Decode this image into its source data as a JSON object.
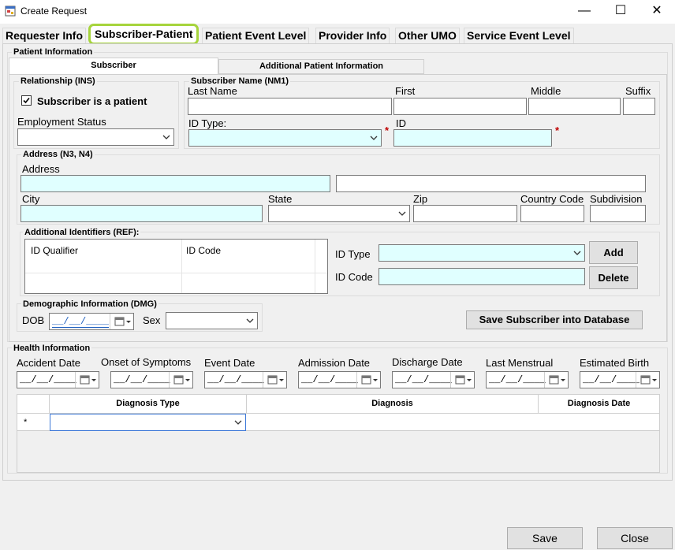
{
  "window": {
    "title": "Create Request",
    "minimize": "—",
    "maximize": "☐",
    "close": "✕"
  },
  "tabs": [
    {
      "label": "Requester Info"
    },
    {
      "label": "Subscriber-Patient"
    },
    {
      "label": "Patient Event Level"
    },
    {
      "label": "Provider Info"
    },
    {
      "label": "Other UMO"
    },
    {
      "label": "Service Event Level"
    }
  ],
  "patient_info": {
    "group_title": "Patient Information",
    "subtabs": [
      {
        "label": "Subscriber"
      },
      {
        "label": "Additional Patient Information"
      }
    ],
    "relationship": {
      "title": "Relationship (INS)",
      "checkbox_label": "Subscriber is a patient",
      "checked": true,
      "employment_label": "Employment Status",
      "employment_value": ""
    },
    "subscriber_name": {
      "title": "Subscriber Name (NM1)",
      "last": "Last Name",
      "first": "First",
      "middle": "Middle",
      "suffix": "Suffix",
      "id_type": "ID Type:",
      "id": "ID",
      "required_mark": "*"
    },
    "address": {
      "title": "Address (N3, N4)",
      "address": "Address",
      "city": "City",
      "state": "State",
      "zip": "Zip",
      "country": "Country Code",
      "subdivision": "Subdivision"
    },
    "ref": {
      "title": "Additional Identifiers (REF):",
      "col1": "ID Qualifier",
      "col2": "ID Code",
      "id_type": "ID Type",
      "id_code": "ID Code",
      "add": "Add",
      "delete": "Delete"
    },
    "dmg": {
      "title": "Demographic Information (DMG)",
      "dob": "DOB",
      "dob_value": "__/__/____",
      "sex": "Sex"
    },
    "save_subscriber": "Save Subscriber into Database"
  },
  "health": {
    "title": "Health Information",
    "dates": [
      {
        "label": "Accident Date",
        "value": "__/__/____"
      },
      {
        "label": "Onset of Symptoms",
        "value": "__/__/____"
      },
      {
        "label": "Event Date",
        "value": "__/__/____"
      },
      {
        "label": "Admission Date",
        "value": "__/__/____"
      },
      {
        "label": "Discharge Date",
        "value": "__/__/____"
      },
      {
        "label": "Last Menstrual",
        "value": "__/__/____"
      },
      {
        "label": "Estimated Birth",
        "value": "__/__/____"
      }
    ],
    "grid": {
      "headers": [
        "Diagnosis Type",
        "Diagnosis",
        "Diagnosis Date"
      ],
      "new_row_marker": "*"
    }
  },
  "footer": {
    "save": "Save",
    "close": "Close"
  }
}
